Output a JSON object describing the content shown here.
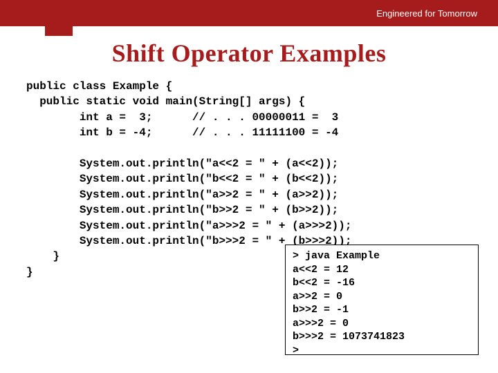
{
  "header": {
    "tagline": "Engineered for Tomorrow"
  },
  "title": "Shift Operator Examples",
  "code": "public class Example {\n  public static void main(String[] args) {\n        int a =  3;      // . . . 00000011 =  3\n        int b = -4;      // . . . 11111100 = -4\n\n        System.out.println(\"a<<2 = \" + (a<<2));\n        System.out.println(\"b<<2 = \" + (b<<2));\n        System.out.println(\"a>>2 = \" + (a>>2));\n        System.out.println(\"b>>2 = \" + (b>>2));\n        System.out.println(\"a>>>2 = \" + (a>>>2));\n        System.out.println(\"b>>>2 = \" + (b>>>2));\n    }\n}",
  "output": "> java Example\na<<2 = 12\nb<<2 = -16\na>>2 = 0\nb>>2 = -1\na>>>2 = 0\nb>>>2 = 1073741823\n>"
}
